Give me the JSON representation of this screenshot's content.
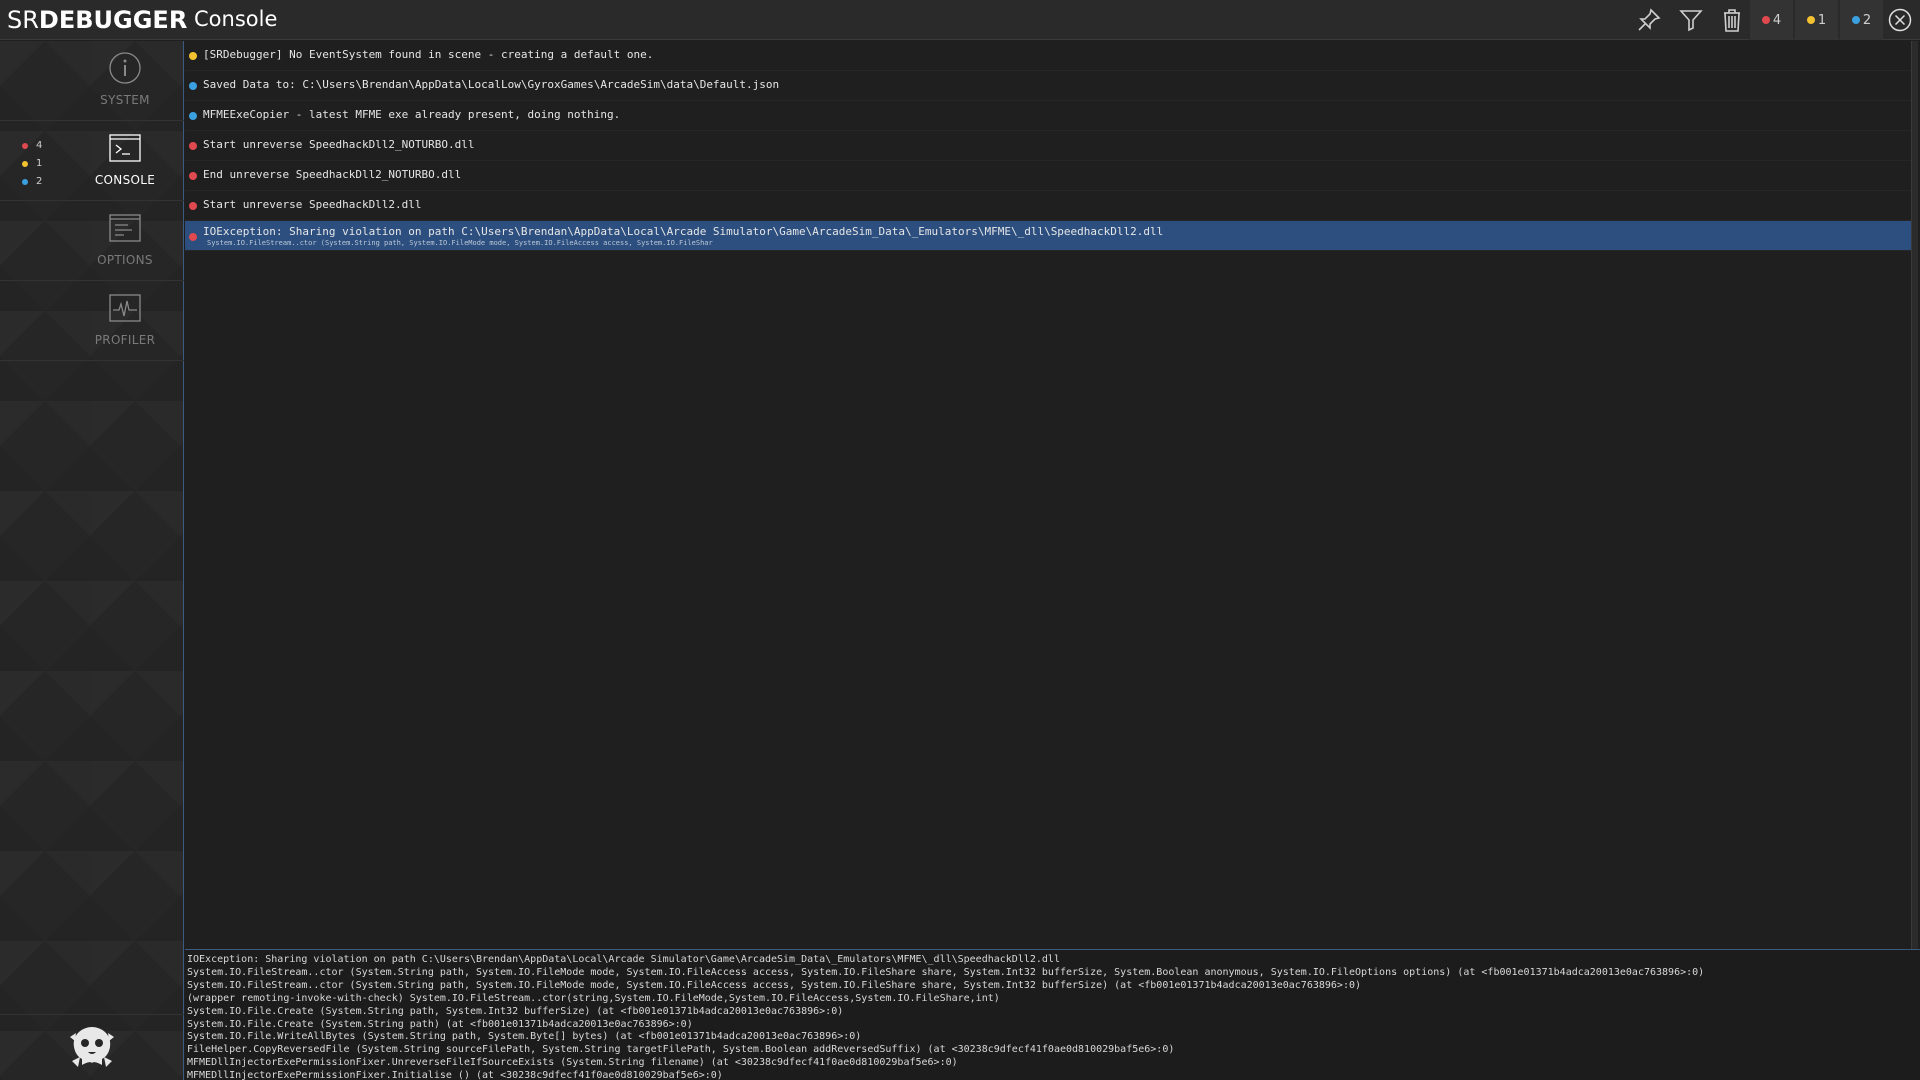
{
  "app": {
    "logo_part1": "SR",
    "logo_part2": "DEBUGGER",
    "page_title": "Console"
  },
  "header": {
    "icons": [
      "pin-icon",
      "filter-icon",
      "trash-icon",
      "close-icon"
    ],
    "counts": {
      "error": "4",
      "warning": "1",
      "info": "2"
    }
  },
  "sidebar": {
    "items": [
      {
        "label": "SYSTEM",
        "icon": "info-icon"
      },
      {
        "label": "CONSOLE",
        "icon": "terminal-icon"
      },
      {
        "label": "OPTIONS",
        "icon": "options-icon"
      },
      {
        "label": "PROFILER",
        "icon": "profiler-icon"
      }
    ],
    "console_counts": {
      "error": "4",
      "warning": "1",
      "info": "2"
    },
    "bottom_icon": "srdebugger-mascot-icon"
  },
  "colors": {
    "error": "#e0494f",
    "warning": "#f2c230",
    "info": "#3aa0e0",
    "selected": "#2c4f7f"
  },
  "console": {
    "entries": [
      {
        "level": "warning",
        "text": "[SRDebugger] No EventSystem found in scene - creating a default one."
      },
      {
        "level": "info",
        "text": "Saved Data to: C:\\Users\\Brendan\\AppData\\LocalLow\\GyroxGames\\ArcadeSim\\data\\Default.json"
      },
      {
        "level": "info",
        "text": "MFMEExeCopier - latest MFME exe already present, doing nothing."
      },
      {
        "level": "error",
        "text": "Start unreverse SpeedhackDll2_NOTURBO.dll"
      },
      {
        "level": "error",
        "text": "End unreverse SpeedhackDll2_NOTURBO.dll"
      },
      {
        "level": "error",
        "text": "Start unreverse SpeedhackDll2.dll"
      },
      {
        "level": "error",
        "text": "IOException: Sharing violation on path C:\\Users\\Brendan\\AppData\\Local\\Arcade Simulator\\Game\\ArcadeSim_Data\\_Emulators\\MFME\\_dll\\SpeedhackDll2.dll",
        "sub": "System.IO.FileStream..ctor (System.String path, System.IO.FileMode mode, System.IO.FileAccess access, System.IO.FileShar"
      }
    ]
  },
  "details": {
    "lines": [
      "IOException: Sharing violation on path C:\\Users\\Brendan\\AppData\\Local\\Arcade Simulator\\Game\\ArcadeSim_Data\\_Emulators\\MFME\\_dll\\SpeedhackDll2.dll",
      "System.IO.FileStream..ctor (System.String path, System.IO.FileMode mode, System.IO.FileAccess access, System.IO.FileShare share, System.Int32 bufferSize, System.Boolean anonymous, System.IO.FileOptions options) (at <fb001e01371b4adca20013e0ac763896>:0)",
      "System.IO.FileStream..ctor (System.String path, System.IO.FileMode mode, System.IO.FileAccess access, System.IO.FileShare share, System.Int32 bufferSize) (at <fb001e01371b4adca20013e0ac763896>:0)",
      "(wrapper remoting-invoke-with-check) System.IO.FileStream..ctor(string,System.IO.FileMode,System.IO.FileAccess,System.IO.FileShare,int)",
      "System.IO.File.Create (System.String path, System.Int32 bufferSize) (at <fb001e01371b4adca20013e0ac763896>:0)",
      "System.IO.File.Create (System.String path) (at <fb001e01371b4adca20013e0ac763896>:0)",
      "System.IO.File.WriteAllBytes (System.String path, System.Byte[] bytes) (at <fb001e01371b4adca20013e0ac763896>:0)",
      "FileHelper.CopyReversedFile (System.String sourceFilePath, System.String targetFilePath, System.Boolean addReversedSuffix) (at <30238c9dfecf41f0ae0d810029baf5e6>:0)",
      "MFMEDllInjectorExePermissionFixer.UnreverseFileIfSourceExists (System.String filename) (at <30238c9dfecf41f0ae0d810029baf5e6>:0)",
      "MFMEDllInjectorExePermissionFixer.Initialise () (at <30238c9dfecf41f0ae0d810029baf5e6>:0)"
    ]
  }
}
